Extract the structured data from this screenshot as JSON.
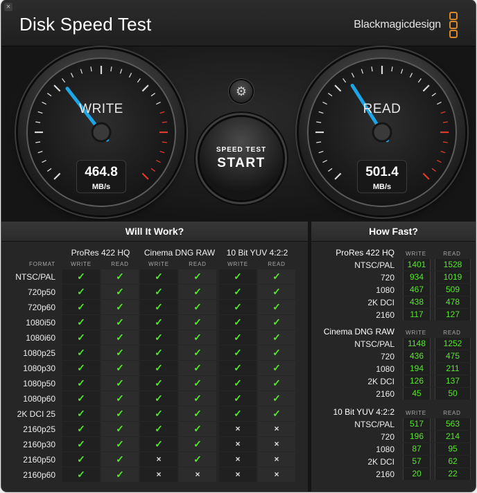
{
  "window": {
    "title": "Disk Speed Test",
    "close_glyph": "×",
    "brand": "Blackmagicdesign"
  },
  "gauges": {
    "write": {
      "label": "WRITE",
      "value": "464.8",
      "unit": "MB/s",
      "needle_fraction": 0.36
    },
    "read": {
      "label": "READ",
      "value": "501.4",
      "unit": "MB/s",
      "needle_fraction": 0.38
    },
    "needle_color": "#1ea5e6",
    "redzone_color": "#e23a2a"
  },
  "controls": {
    "settings_icon": "gear-icon",
    "settings_glyph": "⚙",
    "start_small": "SPEED TEST",
    "start_big": "START"
  },
  "will_it_work": {
    "title": "Will It Work?",
    "format_header": "FORMAT",
    "groups": [
      "ProRes 422 HQ",
      "Cinema DNG RAW",
      "10 Bit YUV 4:2:2"
    ],
    "sub_headers": [
      "WRITE",
      "READ"
    ],
    "check_glyph": "✓",
    "cross_glyph": "×",
    "ok_color": "#55e82a",
    "rows": [
      {
        "format": "NTSC/PAL",
        "cells": [
          1,
          1,
          1,
          1,
          1,
          1
        ]
      },
      {
        "format": "720p50",
        "cells": [
          1,
          1,
          1,
          1,
          1,
          1
        ]
      },
      {
        "format": "720p60",
        "cells": [
          1,
          1,
          1,
          1,
          1,
          1
        ]
      },
      {
        "format": "1080i50",
        "cells": [
          1,
          1,
          1,
          1,
          1,
          1
        ]
      },
      {
        "format": "1080i60",
        "cells": [
          1,
          1,
          1,
          1,
          1,
          1
        ]
      },
      {
        "format": "1080p25",
        "cells": [
          1,
          1,
          1,
          1,
          1,
          1
        ]
      },
      {
        "format": "1080p30",
        "cells": [
          1,
          1,
          1,
          1,
          1,
          1
        ]
      },
      {
        "format": "1080p50",
        "cells": [
          1,
          1,
          1,
          1,
          1,
          1
        ]
      },
      {
        "format": "1080p60",
        "cells": [
          1,
          1,
          1,
          1,
          1,
          1
        ]
      },
      {
        "format": "2K DCI 25",
        "cells": [
          1,
          1,
          1,
          1,
          1,
          1
        ]
      },
      {
        "format": "2160p25",
        "cells": [
          1,
          1,
          1,
          1,
          0,
          0
        ]
      },
      {
        "format": "2160p30",
        "cells": [
          1,
          1,
          1,
          1,
          0,
          0
        ]
      },
      {
        "format": "2160p50",
        "cells": [
          1,
          1,
          0,
          1,
          0,
          0
        ]
      },
      {
        "format": "2160p60",
        "cells": [
          1,
          1,
          0,
          0,
          0,
          0
        ]
      }
    ]
  },
  "how_fast": {
    "title": "How Fast?",
    "write_header": "WRITE",
    "read_header": "READ",
    "groups": [
      {
        "name": "ProRes 422 HQ",
        "rows": [
          {
            "label": "NTSC/PAL",
            "write": "1401",
            "read": "1528"
          },
          {
            "label": "720",
            "write": "934",
            "read": "1019"
          },
          {
            "label": "1080",
            "write": "467",
            "read": "509"
          },
          {
            "label": "2K DCI",
            "write": "438",
            "read": "478"
          },
          {
            "label": "2160",
            "write": "117",
            "read": "127"
          }
        ]
      },
      {
        "name": "Cinema DNG RAW",
        "rows": [
          {
            "label": "NTSC/PAL",
            "write": "1148",
            "read": "1252"
          },
          {
            "label": "720",
            "write": "436",
            "read": "475"
          },
          {
            "label": "1080",
            "write": "194",
            "read": "211"
          },
          {
            "label": "2K DCI",
            "write": "126",
            "read": "137"
          },
          {
            "label": "2160",
            "write": "45",
            "read": "50"
          }
        ]
      },
      {
        "name": "10 Bit YUV 4:2:2",
        "rows": [
          {
            "label": "NTSC/PAL",
            "write": "517",
            "read": "563"
          },
          {
            "label": "720",
            "write": "196",
            "read": "214"
          },
          {
            "label": "1080",
            "write": "87",
            "read": "95"
          },
          {
            "label": "2K DCI",
            "write": "57",
            "read": "62"
          },
          {
            "label": "2160",
            "write": "20",
            "read": "22"
          }
        ]
      }
    ]
  }
}
